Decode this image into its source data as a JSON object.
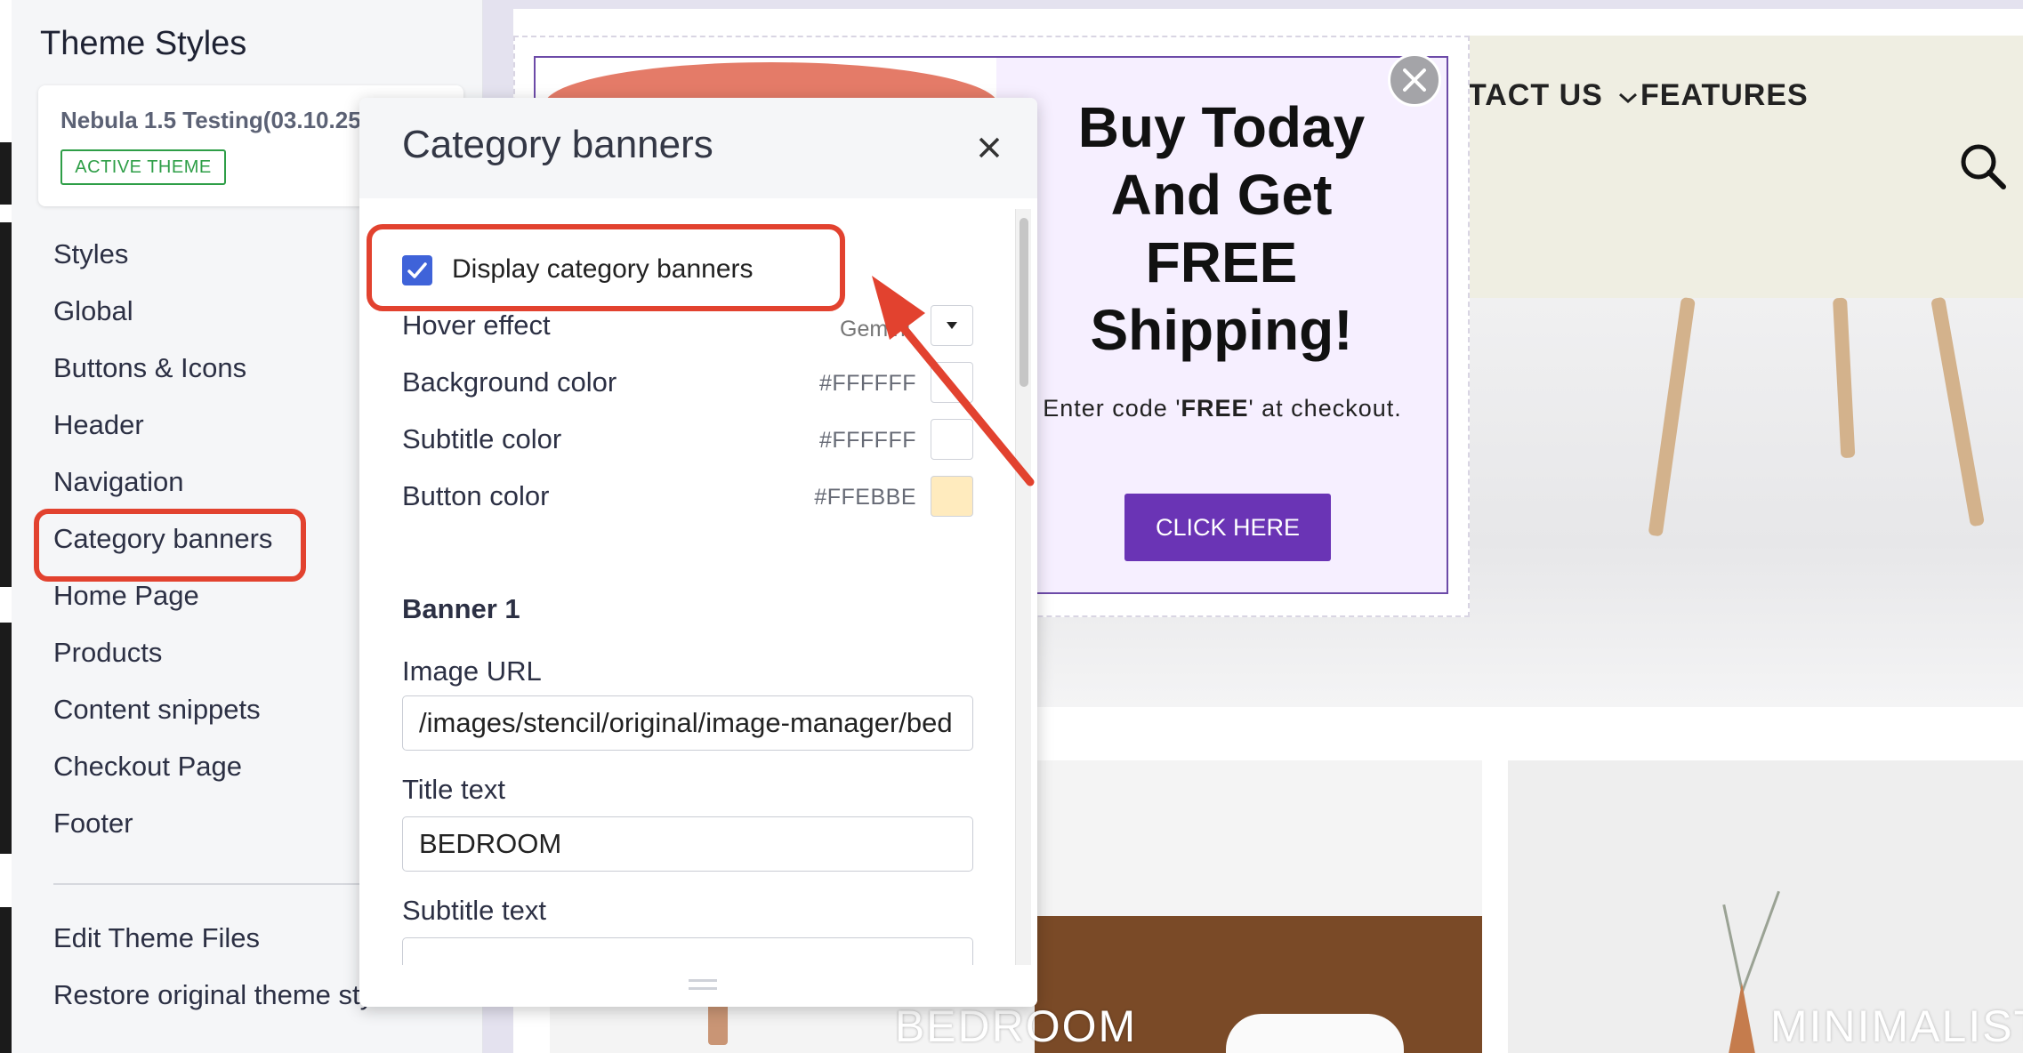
{
  "sidebar": {
    "title": "Theme Styles",
    "theme_name": "Nebula 1.5 Testing(03.10.25)",
    "active_badge": "ACTIVE THEME",
    "items": [
      {
        "label": "Styles"
      },
      {
        "label": "Global"
      },
      {
        "label": "Buttons & Icons"
      },
      {
        "label": "Header"
      },
      {
        "label": "Navigation"
      },
      {
        "label": "Category banners"
      },
      {
        "label": "Home Page"
      },
      {
        "label": "Products"
      },
      {
        "label": "Content snippets"
      },
      {
        "label": "Checkout Page"
      },
      {
        "label": "Footer"
      }
    ],
    "footer_items": [
      {
        "label": "Edit Theme Files"
      },
      {
        "label": "Restore original theme sty"
      }
    ]
  },
  "panel": {
    "title": "Category banners",
    "display_label": "Display category banners",
    "display_checked": true,
    "hover_label": "Hover effect",
    "hover_value": "Gemini",
    "colors": [
      {
        "label": "Background color",
        "hex": "#FFFFFF",
        "swatch": "#FFFFFF"
      },
      {
        "label": "Subtitle color",
        "hex": "#FFFFFF",
        "swatch": "#FFFFFF"
      },
      {
        "label": "Button color",
        "hex": "#FFEBBE",
        "swatch": "#FFEBBE"
      }
    ],
    "banner_title": "Banner 1",
    "image_url_label": "Image URL",
    "image_url_value": "/images/stencil/original/image-manager/bed",
    "title_text_label": "Title text",
    "title_text_value": "BEDROOM",
    "subtitle_text_label": "Subtitle text",
    "subtitle_text_value": ""
  },
  "store": {
    "nav": [
      "TACT US",
      "FEATURES"
    ],
    "categories": [
      "BEDROOM",
      "MINIMALISTI"
    ]
  },
  "popup": {
    "heading_lines": [
      "Buy Today",
      "And Get",
      "FREE",
      "Shipping!"
    ],
    "text_before": "Enter code '",
    "code": "FREE",
    "text_after": "' at checkout.",
    "cta": "CLICK HERE"
  },
  "colors": {
    "highlight": "#e2422f",
    "accent_purple": "#6a34b5",
    "checkbox_blue": "#3f63d9",
    "badge_green": "#2e9e47"
  },
  "icons": [
    "close-icon",
    "popup-close-icon",
    "chevron-down-icon",
    "search-icon",
    "checkmark-icon",
    "dropdown-arrow-icon"
  ]
}
